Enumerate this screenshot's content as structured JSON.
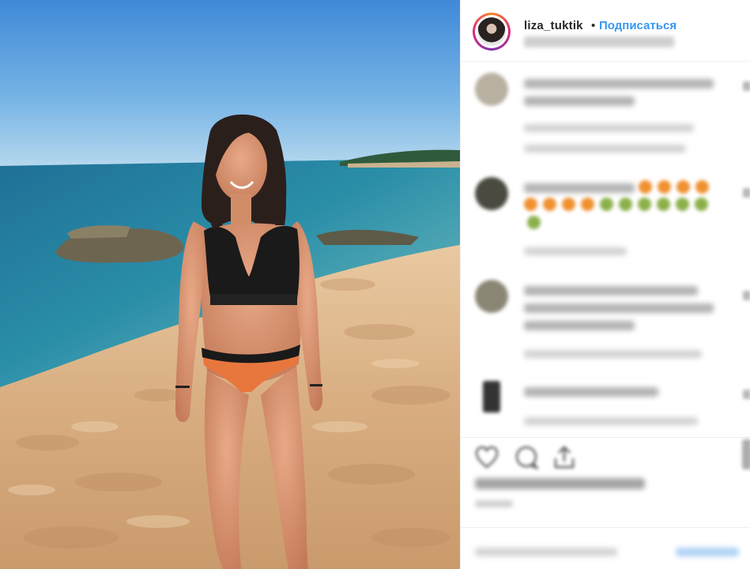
{
  "post": {
    "photo_alt": "beach-photo",
    "header": {
      "username": "liza_tuktik",
      "separator": "•",
      "follow_label": "Подписаться"
    }
  },
  "colors": {
    "follow_blue": "#3897f0",
    "username": "#262626"
  },
  "icons": {
    "like": "heart-icon",
    "comment": "comment-bubble-icon",
    "share": "share-icon",
    "save": "bookmark-icon"
  }
}
